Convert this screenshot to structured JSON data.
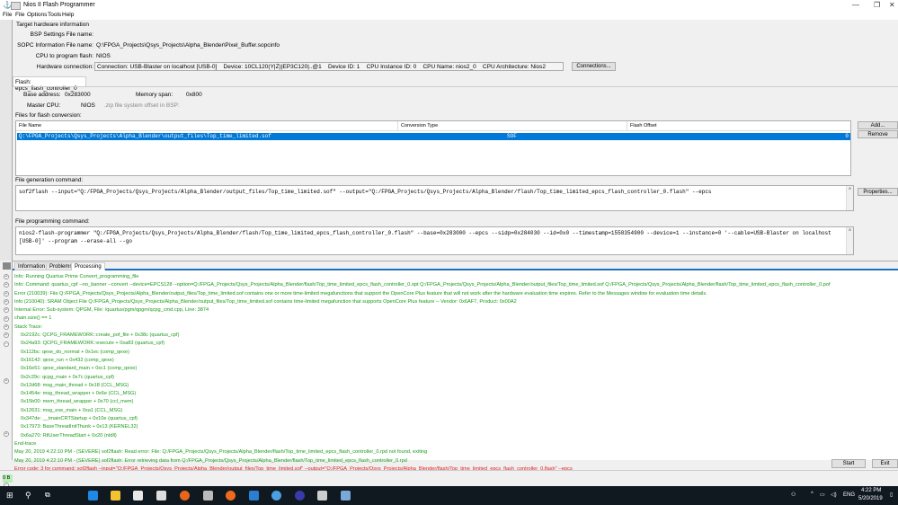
{
  "window": {
    "title": "Nios II Flash Programmer",
    "menu": [
      "File",
      "File",
      "Options",
      "Tools",
      "Help"
    ]
  },
  "target": {
    "heading": "Target hardware information",
    "bsp_label": "BSP Settings File name:",
    "bsp_value": "",
    "sopc_label": "SOPC Information File name:",
    "sopc_value": "Q:\\FPGA_Projects\\Qsys_Projects\\Alpha_Blender\\Pixel_Buffer.sopcinfo",
    "cpu_label": "CPU to program flash:",
    "cpu_value": "NIOS",
    "hw_label": "Hardware connection:",
    "hw_value": "Connection: USB-Blaster on localhost [USB-0]    Device: 10CL120(Y|Z)|EP3C120|..@1    Device ID: 1    CPU Instance ID: 0    CPU Name: nios2_0    CPU Architecture: Nios2",
    "connections_button": "Connections..."
  },
  "flash": {
    "tab": "Flash: epcs_flash_controller_0",
    "base_label": "Base address:",
    "base_value": "0x283000",
    "span_label": "Memory span:",
    "span_value": "0x800",
    "master_label": "Master CPU:",
    "master_value": "NIOS",
    "zip_label": ".zip file system offset in BSP:"
  },
  "files": {
    "heading": "Files for flash conversion:",
    "columns": [
      "File Name",
      "Conversion Type",
      "Flash Offset"
    ],
    "rows": [
      {
        "file": "Q:\\FPGA_Projects\\Qsys_Projects\\Alpha_Blender\\output_files\\Top_time_limited.sof",
        "type": "SOF",
        "offset": "0"
      }
    ],
    "add_button": "Add...",
    "remove_button": "Remove"
  },
  "gen": {
    "label": "File generation command:",
    "value": "sof2flash --input=\"Q:/FPGA_Projects/Qsys_Projects/Alpha_Blender/output_files/Top_time_limited.sof\" --output=\"Q:/FPGA_Projects/Qsys_Projects/Alpha_Blender/flash/Top_time_limited_epcs_flash_controller_0.flash\" --epcs",
    "properties_button": "Properties..."
  },
  "prog": {
    "label": "File programming command:",
    "value": "nios2-flash-programmer \"Q:/FPGA_Projects/Qsys_Projects/Alpha_Blender/flash/Top_time_limited_epcs_flash_controller_0.flash\" --base=0x283000 --epcs --sidp=0x284030 --id=0x0 --timestamp=1558354900 --device=1 --instance=0 '--cable=USB-Blaster on localhost\n[USB-0]' --program --erase-all --go"
  },
  "messages": {
    "tabs": [
      "Information",
      "Problems",
      "Processing"
    ],
    "active_tab": "Processing",
    "lines": [
      {
        "t": "Info: Running Quartus Prime Convert_programming_file",
        "k": "info"
      },
      {
        "t": "Info: Command: quartus_cpf --no_banner --convert --device=EPCS128 --option=Q:/FPGA_Projects/Qsys_Projects/Alpha_Blender/flash/Top_time_limited_epcs_flash_controller_0.opt Q:/FPGA_Projects/Qsys_Projects/Alpha_Blender/output_files/Top_time_limited.sof Q:/FPGA_Projects/Qsys_Projects/Alpha_Blender/flash/Top_time_limited_epcs_flash_controller_0.pof",
        "k": "info"
      },
      {
        "t": "Error (210039): File Q:/FPGA_Projects/Qsys_Projects/Alpha_Blender/output_files/Top_time_limited.sof contains one or more time-limited megafunctions that support the OpenCore Plus feature that will not work after the hardware evaluation time expires. Refer to the Messages window for evaluation time details.",
        "k": "info"
      },
      {
        "t": "Info (210040): SRAM Object File Q:/FPGA_Projects/Qsys_Projects/Alpha_Blender/output_files/Top_time_limited.sof contains time-limited megafunction that supports OpenCore Plus feature -- Vendor: 0x6AF7, Product: 0x00A2",
        "k": "info"
      },
      {
        "t": "Internal Error: Sub-system: QPGM, File: /quartus/pgm/qpgm/qcpg_cmd.cpp, Line: 3874",
        "k": "info"
      },
      {
        "t": "chain.size() == 1",
        "k": "info"
      },
      {
        "t": "Stack Trace:",
        "k": "info"
      },
      {
        "t": "0x2192c: QCPG_FRAMEWORK::create_pof_file + 0x38c (quartus_cpf)",
        "k": "ind"
      },
      {
        "t": "0x24a93: QCPG_FRAMEWORK::execute + 0xa83 (quartus_cpf)",
        "k": "ind"
      },
      {
        "t": "0x112bc: qexe_do_normal + 0x1ec (comp_qexe)",
        "k": "ind"
      },
      {
        "t": "0x16142: qexe_run + 0x432 (comp_qexe)",
        "k": "ind"
      },
      {
        "t": "0x16e51: qexe_standard_main + 0xc1 (comp_qexe)",
        "k": "ind"
      },
      {
        "t": "0x2c29c: qcpg_main + 0x7c (quartus_cpf)",
        "k": "ind"
      },
      {
        "t": "0x12d68: msg_main_thread + 0x18 (CCL_MSG)",
        "k": "ind"
      },
      {
        "t": "0x1454e: msg_thread_wrapper + 0x6e (CCL_MSG)",
        "k": "ind"
      },
      {
        "t": "0x15b00: mem_thread_wrapper + 0x70 (ccl_mem)",
        "k": "ind"
      },
      {
        "t": "0x12631: msg_exe_main + 0xa1 (CCL_MSG)",
        "k": "ind"
      },
      {
        "t": "0x347de: __tmainCRTStartup + 0x10e (quartus_cpf)",
        "k": "ind"
      },
      {
        "t": "0x17973: BaseThreadInitThunk + 0x13 (KERNEL32)",
        "k": "ind"
      },
      {
        "t": "0x6a270: RtlUserThreadStart + 0x20 (ntdll)",
        "k": "ind"
      },
      {
        "t": "End-trace",
        "k": "info"
      },
      {
        "t": "May 20, 2019 4:22:10 PM - (SEVERE) sof2flash: Read error: File: Q:/FPGA_Projects/Qsys_Projects/Alpha_Blender/flash/Top_time_limited_epcs_flash_controller_0.rpd not found, exiting",
        "k": "info"
      },
      {
        "t": "May 20, 2019 4:22:10 PM - (SEVERE) sof2flash: Error retrieving data from Q:/FPGA_Projects/Qsys_Projects/Alpha_Blender/flash/Top_time_limited_epcs_flash_controller_0.rpd",
        "k": "info"
      },
      {
        "t": "Error code: 3 for command: sof2flash --input=\"Q:/FPGA_Projects/Qsys_Projects/Alpha_Blender/output_files/Top_time_limited.sof\" --output=\"Q:/FPGA_Projects/Qsys_Projects/Alpha_Blender/flash/Top_time_limited_epcs_flash_controller_0.flash\" --epcs",
        "k": "err"
      }
    ]
  },
  "actions": {
    "start": "Start",
    "exit": "Exit"
  },
  "status": {
    "text": "0 B"
  },
  "taskbar": {
    "lang": "ENG",
    "time": "4:22 PM",
    "date": "5/20/2019"
  },
  "colors": {
    "selection": "#0078d7",
    "info_text": "#1a9a1a",
    "error_text": "#e02020",
    "taskbar": "#101820"
  }
}
